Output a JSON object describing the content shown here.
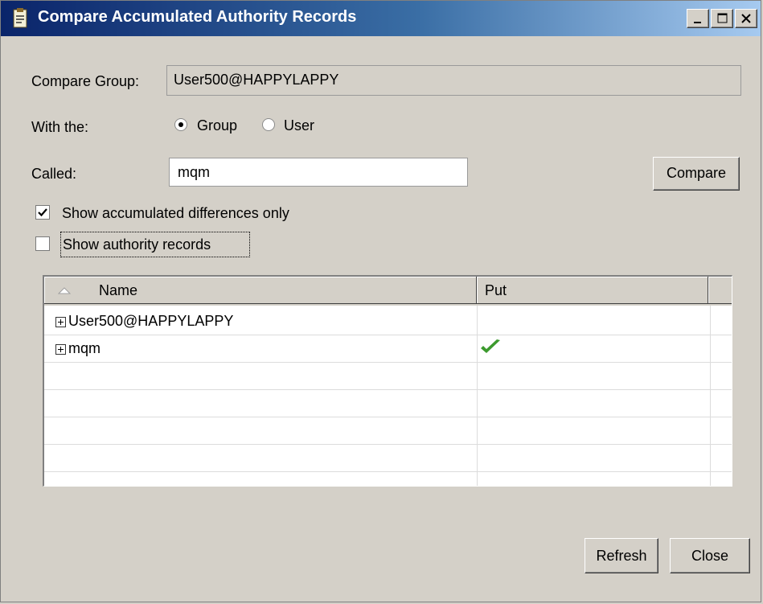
{
  "window": {
    "title": "Compare Accumulated Authority Records",
    "icon": "authority-records-icon",
    "controls": [
      "minimize-icon",
      "maximize-icon",
      "close-icon"
    ]
  },
  "form": {
    "compare_group_label": "Compare Group:",
    "compare_group_value": "User500@HAPPYLAPPY",
    "with_the_label": "With the:",
    "radio_group_label": "Group",
    "radio_user_label": "User",
    "selected_radio": "Group",
    "called_label": "Called:",
    "called_value": "mqm",
    "compare_button": "Compare",
    "show_diff_label": "Show accumulated differences only",
    "show_diff_checked": true,
    "show_records_label": "Show authority records",
    "show_records_checked": false
  },
  "table": {
    "columns": [
      "Name",
      "Put"
    ],
    "sort_indicator": "sort-ascending-icon",
    "rows": [
      {
        "name": "User500@HAPPYLAPPY",
        "put": "",
        "expandable": true
      },
      {
        "name": "mqm",
        "put": "check-icon",
        "expandable": true
      }
    ],
    "check_color": "#3c9a2e"
  },
  "footer": {
    "refresh_button": "Refresh",
    "close_button": "Close"
  }
}
